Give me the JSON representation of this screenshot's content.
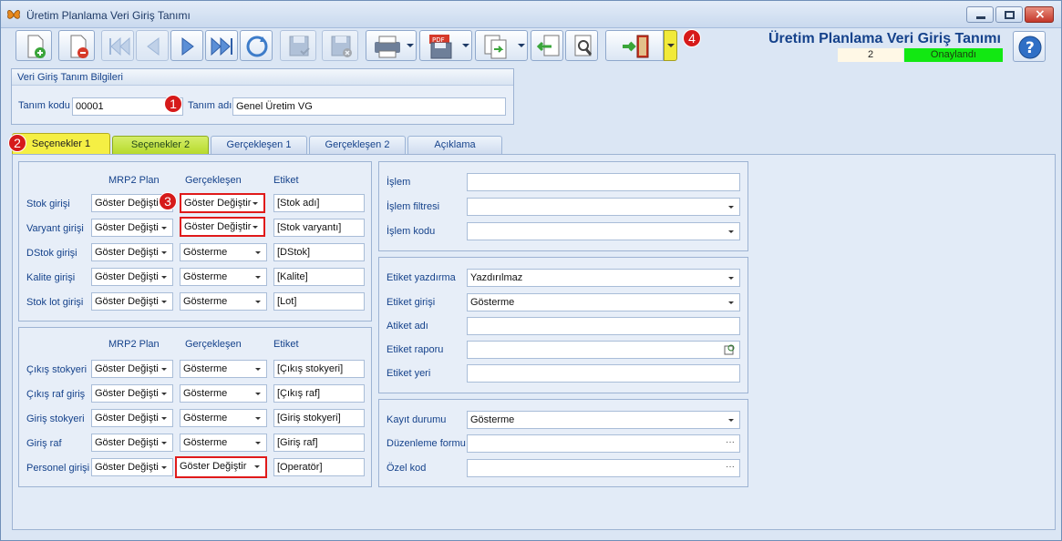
{
  "window": {
    "title": "Üretim Planlama Veri Giriş Tanımı",
    "logo_icon": "butterfly-icon"
  },
  "toolbar": {
    "buttons": [
      "new-record-icon",
      "delete-record-icon",
      "first-icon",
      "prev-icon",
      "next-icon",
      "last-icon",
      "refresh-icon",
      "save-icon",
      "save-close-icon",
      "print-icon",
      "pdf-export-icon",
      "copy-icon",
      "import-icon",
      "search-icon",
      "exit-icon"
    ]
  },
  "header": {
    "form_title": "Üretim Planlama Veri Giriş Tanımı",
    "record_no": "2",
    "status": "Onaylandı",
    "status_color": "#12e812"
  },
  "info_group": {
    "title": "Veri Giriş Tanım Bilgileri",
    "code_label": "Tanım kodu",
    "code_value": "00001",
    "name_label": "Tanım adı",
    "name_value": "Genel Üretim VG"
  },
  "badges": [
    "1",
    "2",
    "3",
    "4"
  ],
  "tabs": [
    "Seçenekler 1",
    "Seçenekler 2",
    "Gerçekleşen 1",
    "Gerçekleşen 2",
    "Açıklama"
  ],
  "group_a": {
    "headers": [
      "MRP2 Plan",
      "Gerçekleşen",
      "Etiket"
    ],
    "rows": [
      {
        "label": "Stok girişi",
        "plan": "Göster Değişti",
        "real": "Göster Değiştir",
        "tag": "[Stok adı]"
      },
      {
        "label": "Varyant girişi",
        "plan": "Göster Değişti",
        "real": "Göster Değiştir",
        "tag": "[Stok varyantı]"
      },
      {
        "label": "DStok girişi",
        "plan": "Göster Değişti",
        "real": "Gösterme",
        "tag": "[DStok]"
      },
      {
        "label": "Kalite girişi",
        "plan": "Göster Değişti",
        "real": "Gösterme",
        "tag": "[Kalite]"
      },
      {
        "label": "Stok lot girişi",
        "plan": "Göster Değişti",
        "real": "Gösterme",
        "tag": "[Lot]"
      }
    ]
  },
  "group_b": {
    "headers": [
      "MRP2 Plan",
      "Gerçekleşen",
      "Etiket"
    ],
    "rows": [
      {
        "label": "Çıkış stokyeri",
        "plan": "Göster Değişti",
        "real": "Gösterme",
        "tag": "[Çıkış stokyeri]"
      },
      {
        "label": "Çıkış raf giriş",
        "plan": "Göster Değişti",
        "real": "Gösterme",
        "tag": "[Çıkış raf]"
      },
      {
        "label": "Giriş stokyeri",
        "plan": "Göster Değişti",
        "real": "Gösterme",
        "tag": "[Giriş stokyeri]"
      },
      {
        "label": "Giriş raf",
        "plan": "Göster Değişti",
        "real": "Gösterme",
        "tag": "[Giriş raf]"
      },
      {
        "label": "Personel girişi",
        "plan": "Göster Değişti",
        "real": "Göster Değiştir",
        "tag": "[Operatör]"
      }
    ]
  },
  "right1": [
    {
      "label": "İşlem",
      "value": ""
    },
    {
      "label": "İşlem filtresi",
      "value": ""
    },
    {
      "label": "İşlem kodu",
      "value": ""
    }
  ],
  "right2": [
    {
      "label": "Etiket yazdırma",
      "value": "Yazdırılmaz"
    },
    {
      "label": "Etiket girişi",
      "value": "Gösterme"
    },
    {
      "label": "Atiket adı",
      "value": ""
    },
    {
      "label": "Etiket raporu",
      "value": ""
    },
    {
      "label": "Etiket yeri",
      "value": ""
    }
  ],
  "right3": [
    {
      "label": "Kayıt durumu",
      "value": "Gösterme"
    },
    {
      "label": "Düzenleme formu",
      "value": ""
    },
    {
      "label": "Özel kod",
      "value": ""
    }
  ]
}
